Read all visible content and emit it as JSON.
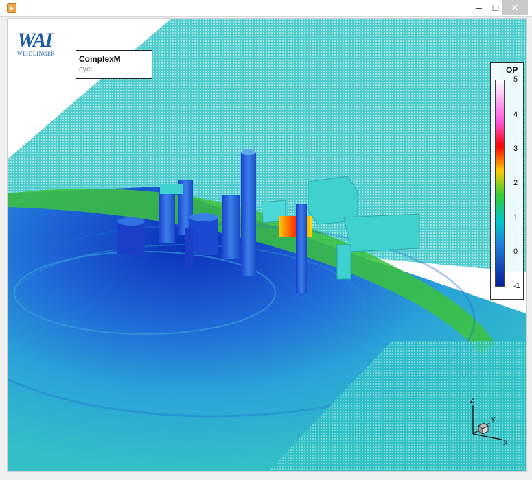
{
  "window": {
    "title": "",
    "controls": {
      "minimize": "–",
      "maximize": "□",
      "close": "✕"
    }
  },
  "logo": {
    "mark": "WAI",
    "text": "WEIDLINGER"
  },
  "plot_title": {
    "title": "ComplexM",
    "subtitle": "cycl"
  },
  "legend": {
    "title": "OP",
    "ticks": [
      "5",
      "4",
      "3",
      "2",
      "1",
      "0",
      "-1"
    ],
    "colormap": [
      "#ffffff",
      "#ff55e0",
      "#ff0000",
      "#ffcc00",
      "#33cc33",
      "#00c8c8",
      "#1f7fe0",
      "#0a1f9a"
    ]
  },
  "axes_triad": {
    "z": "Z",
    "y": "Y",
    "x": "X"
  },
  "icons": {
    "app": "application-icon",
    "minimize": "minimize-icon",
    "maximize": "maximize-icon",
    "close": "close-icon"
  }
}
